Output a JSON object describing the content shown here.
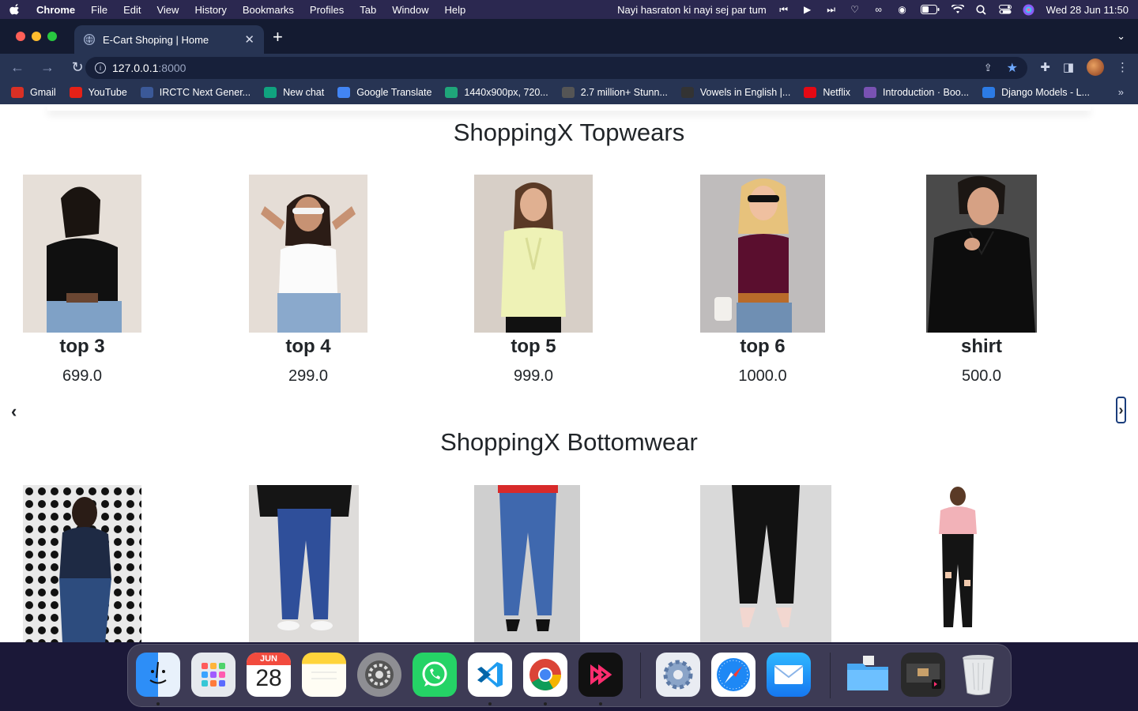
{
  "menubar": {
    "app": "Chrome",
    "items": [
      "File",
      "Edit",
      "View",
      "History",
      "Bookmarks",
      "Profiles",
      "Tab",
      "Window",
      "Help"
    ],
    "now_playing": "Nayi hasraton ki nayi sej par tum",
    "datetime": "Wed 28 Jun  11:50"
  },
  "browser": {
    "tab_title": "E-Cart Shoping | Home",
    "url_host": "127.0.0.1",
    "url_port": ":8000",
    "bookmarks": [
      {
        "label": "Gmail",
        "icon": "gmail-icon",
        "color": "#d93025"
      },
      {
        "label": "YouTube",
        "icon": "youtube-icon",
        "color": "#e62117"
      },
      {
        "label": "IRCTC Next Gener...",
        "icon": "irctc-icon",
        "color": "#3b5998"
      },
      {
        "label": "New chat",
        "icon": "chatgpt-icon",
        "color": "#10a37f"
      },
      {
        "label": "Google Translate",
        "icon": "translate-icon",
        "color": "#4285f4"
      },
      {
        "label": "1440x900px, 720...",
        "icon": "wallpaper-site-icon",
        "color": "#1fa67a"
      },
      {
        "label": "2.7 million+ Stunn...",
        "icon": "stock-photo-icon",
        "color": "#555555"
      },
      {
        "label": "Vowels in English |...",
        "icon": "vowels-site-icon",
        "color": "#333333"
      },
      {
        "label": "Netflix",
        "icon": "netflix-icon",
        "color": "#e50914"
      },
      {
        "label": "Introduction · Boo...",
        "icon": "bootstrap-icon",
        "color": "#7952b3"
      },
      {
        "label": "Django Models - L...",
        "icon": "django-site-icon",
        "color": "#2c7be5"
      }
    ]
  },
  "page": {
    "topwear": {
      "title": "ShoppingX Topwears",
      "products": [
        {
          "name": "top 3",
          "price": "699.0"
        },
        {
          "name": "top 4",
          "price": "299.0"
        },
        {
          "name": "top 5",
          "price": "999.0"
        },
        {
          "name": "top 6",
          "price": "1000.0"
        },
        {
          "name": "shirt",
          "price": "500.0"
        }
      ]
    },
    "bottomwear": {
      "title": "ShoppingX Bottomwear"
    },
    "carousel": {
      "prev": "‹",
      "next": "›"
    }
  },
  "dock": {
    "calendar_month": "JUN",
    "calendar_day": "28",
    "apps": [
      "finder-icon",
      "launchpad-icon",
      "calendar-icon",
      "notes-icon",
      "system-settings-icon",
      "whatsapp-icon",
      "vscode-icon",
      "chrome-icon",
      "screen-recorder-icon",
      "system-preferences-icon",
      "safari-icon",
      "mail-icon",
      "downloads-folder-icon",
      "recent-screenshots-icon",
      "trash-icon"
    ]
  },
  "colors": {
    "accent_border": "#1a3d7c",
    "chrome_toolbar": "#273453",
    "menubar": "#2b2850"
  }
}
